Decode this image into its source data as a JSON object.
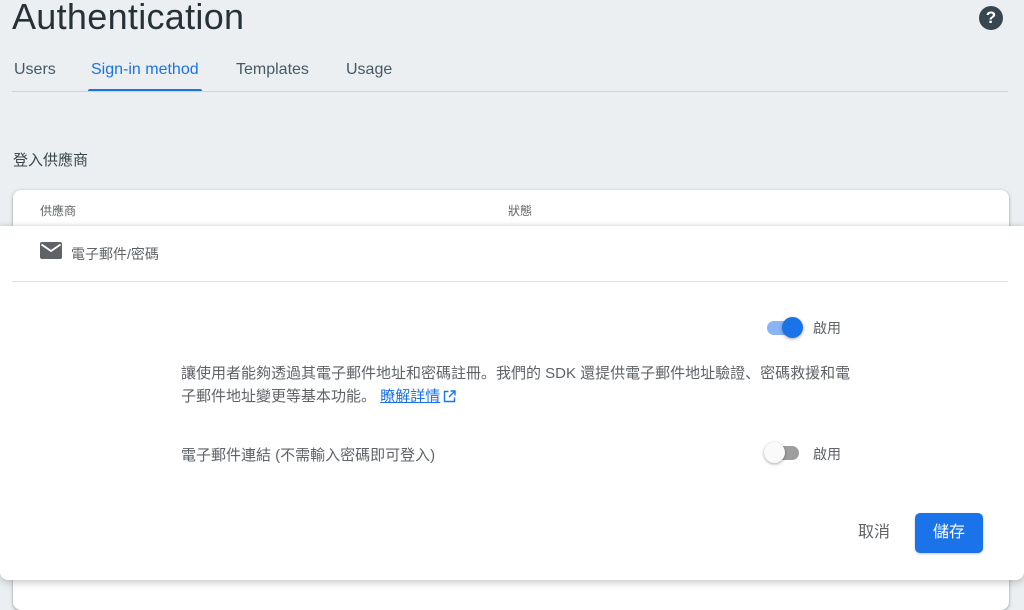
{
  "header": {
    "title": "Authentication",
    "help_icon": "help-circle-icon"
  },
  "tabs": [
    {
      "label": "Users",
      "active": false
    },
    {
      "label": "Sign-in method",
      "active": true
    },
    {
      "label": "Templates",
      "active": false
    },
    {
      "label": "Usage",
      "active": false
    }
  ],
  "section": {
    "title": "登入供應商"
  },
  "table": {
    "columns": [
      "供應商",
      "狀態"
    ]
  },
  "panel": {
    "provider_icon": "mail-icon",
    "provider_name": "電子郵件/密碼",
    "main_toggle": {
      "label": "啟用",
      "enabled": true
    },
    "description": "讓使用者能夠透過其電子郵件地址和密碼註冊。我們的 SDK 還提供電子郵件地址驗證、密碼救援和電子郵件地址變更等基本功能。",
    "learn_more": "瞭解詳情",
    "email_link": {
      "label": "電子郵件連結 (不需輸入密碼即可登入)",
      "toggle_label": "啟用",
      "enabled": false
    },
    "cancel_label": "取消",
    "save_label": "儲存"
  },
  "colors": {
    "accent": "#1a73e8",
    "background": "#eceff1",
    "title": "#263238"
  }
}
